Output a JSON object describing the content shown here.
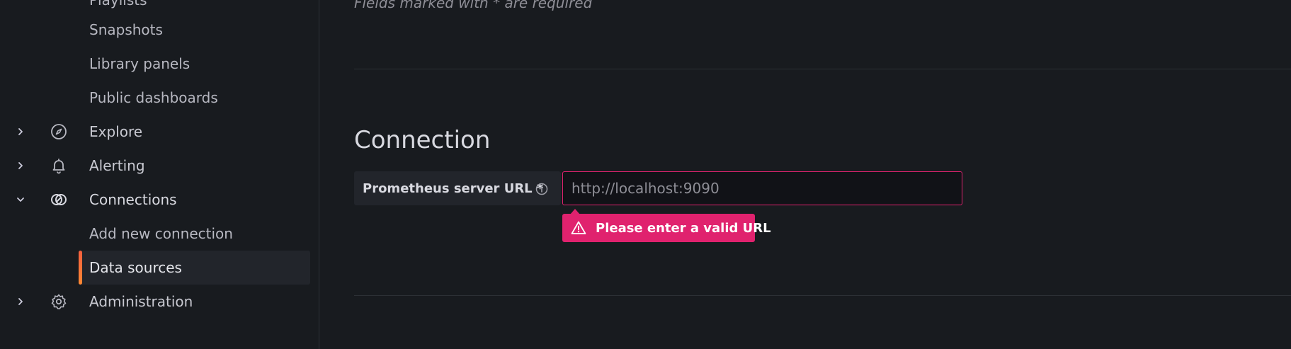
{
  "sidebar": {
    "items": [
      {
        "label": "Playlists",
        "icon": "none"
      },
      {
        "label": "Snapshots",
        "icon": "none"
      },
      {
        "label": "Library panels",
        "icon": "none"
      },
      {
        "label": "Public dashboards",
        "icon": "none"
      },
      {
        "label": "Explore",
        "icon": "compass-icon",
        "expanded": false
      },
      {
        "label": "Alerting",
        "icon": "bell-icon",
        "expanded": false
      },
      {
        "label": "Connections",
        "icon": "connections-icon",
        "expanded": true
      },
      {
        "label": "Add new connection",
        "icon": "none"
      },
      {
        "label": "Data sources",
        "icon": "none",
        "active": true
      },
      {
        "label": "Administration",
        "icon": "gear-icon",
        "expanded": false
      }
    ],
    "active_accent": "#f55f3e"
  },
  "main": {
    "required_note": "Fields marked with * are required",
    "section_title": "Connection",
    "url_field": {
      "label": "Prometheus server URL *",
      "value": "",
      "placeholder": "http://localhost:9090"
    },
    "error_message": "Please enter a valid URL",
    "error_color": "#e0226e"
  }
}
